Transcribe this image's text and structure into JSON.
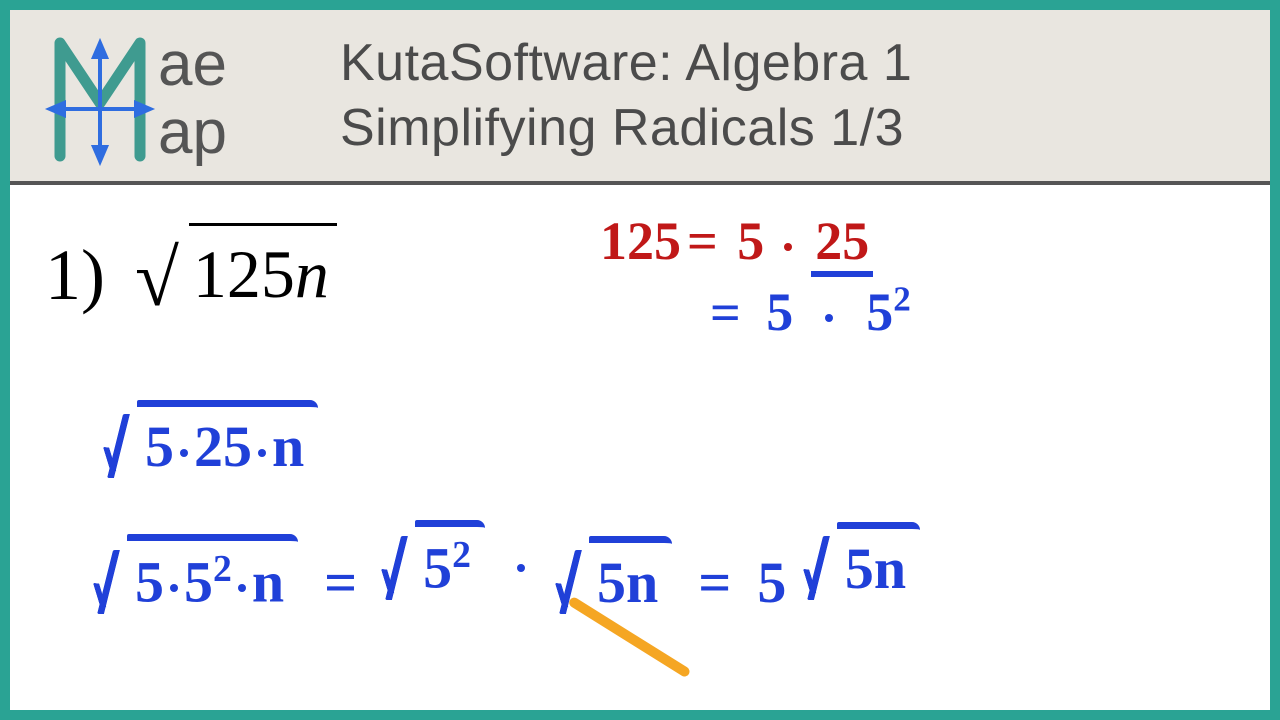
{
  "header": {
    "title_line1": "KutaSoftware: Algebra 1",
    "title_line2": "Simplifying Radicals 1/3",
    "logo": {
      "top": "ae",
      "bottom": "ap"
    }
  },
  "problem": {
    "number": "1)",
    "radicand": "125",
    "variable": "n"
  },
  "work": {
    "factor_line1_a": "125",
    "factor_line1_eq": "=",
    "factor_line1_b": "5",
    "factor_line1_c": "25",
    "factor_line2_eq": "=",
    "factor_line2_a": "5",
    "factor_line2_b": "5",
    "factor_line2_exp": "2",
    "sqrt1_a": "5",
    "sqrt1_b": "25",
    "sqrt1_c": "n",
    "sqrt2_a": "5",
    "sqrt2_b": "5",
    "sqrt2_bexp": "2",
    "sqrt2_c": "n",
    "eq": "=",
    "mid1_base": "5",
    "mid1_exp": "2",
    "mid2_a": "5",
    "mid2_b": "n",
    "final_coeff": "5",
    "final_a": "5",
    "final_b": "n"
  }
}
